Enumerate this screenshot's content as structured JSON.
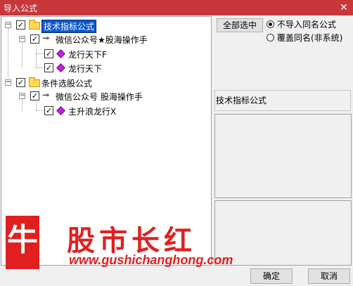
{
  "window": {
    "title": "导入公式",
    "close": "✕"
  },
  "tree": {
    "n1": {
      "label": "技术指标公式"
    },
    "n1a": {
      "label": "微信公众号★股海操作手"
    },
    "n1a1": {
      "label": "龙行天下F"
    },
    "n1a2": {
      "label": "龙行天下"
    },
    "n2": {
      "label": "条件选股公式"
    },
    "n2a": {
      "label": "微信公众号 股海操作手"
    },
    "n2a1": {
      "label": "主升浪龙行X"
    }
  },
  "options": {
    "select_all": "全部选中",
    "radio1": "不导入同名公式",
    "radio2": "覆盖同名(非系统)"
  },
  "info": {
    "heading": "技术指标公式"
  },
  "watermark": {
    "brand": "股市长红",
    "badge": "牛",
    "url": "www.gushichanghong.com"
  },
  "footer": {
    "ok": "确定",
    "cancel": "取消"
  }
}
